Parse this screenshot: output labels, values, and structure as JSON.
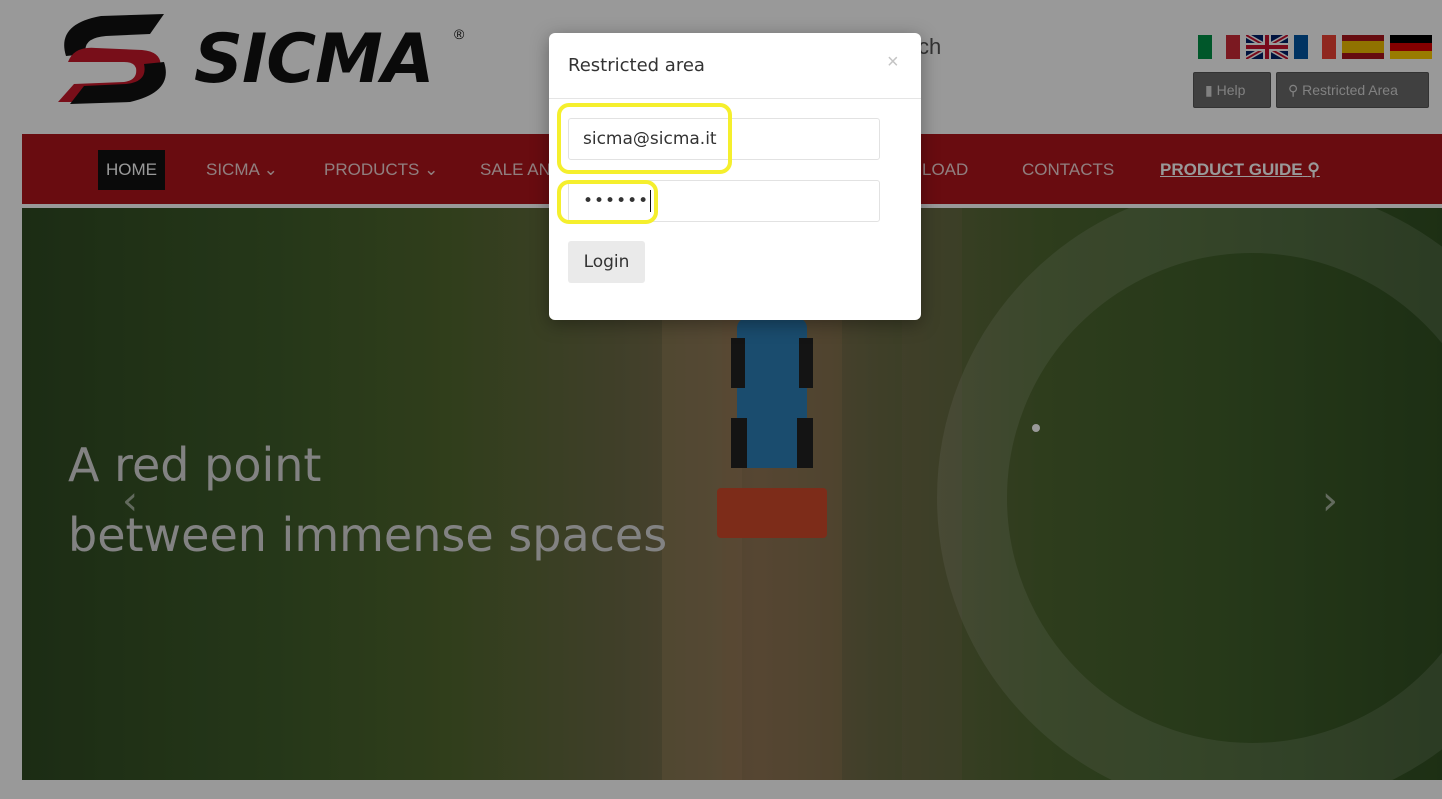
{
  "header": {
    "logo_text": "SICMA",
    "logo_reg": "®",
    "search_fragment": "ch",
    "help_label": "Help",
    "restricted_label": "Restricted Area",
    "flags": [
      {
        "name": "flag-italy-icon",
        "colors": [
          "#009246",
          "#ffffff",
          "#ce2b37"
        ]
      },
      {
        "name": "flag-uk-icon",
        "colors": [
          "#012169",
          "#ffffff",
          "#c8102e"
        ]
      },
      {
        "name": "flag-france-icon",
        "colors": [
          "#0055a4",
          "#ffffff",
          "#ef4135"
        ]
      },
      {
        "name": "flag-spain-icon",
        "colors": [
          "#aa151b",
          "#f1bf00",
          "#aa151b"
        ]
      },
      {
        "name": "flag-germany-icon",
        "colors": [
          "#000000",
          "#dd0000",
          "#ffce00"
        ]
      }
    ]
  },
  "nav": {
    "home": "HOME",
    "sicma": "SICMA ⌄",
    "products": "PRODUCTS ⌄",
    "sale": "SALE AN",
    "download": "LOAD",
    "contacts": "CONTACTS",
    "guide": "PRODUCT GUIDE",
    "guide_icon": "search-icon"
  },
  "hero": {
    "line1": "A red point",
    "line2": "between immense spaces",
    "prev_arrow": "‹",
    "next_arrow": "›"
  },
  "modal": {
    "title": "Restricted area",
    "close": "×",
    "email_value": "sicma@sicma.it",
    "password_mask": "••••••",
    "login_label": "Login"
  },
  "colors": {
    "brand_red": "#b0141b",
    "highlight": "#f5ef2d"
  }
}
